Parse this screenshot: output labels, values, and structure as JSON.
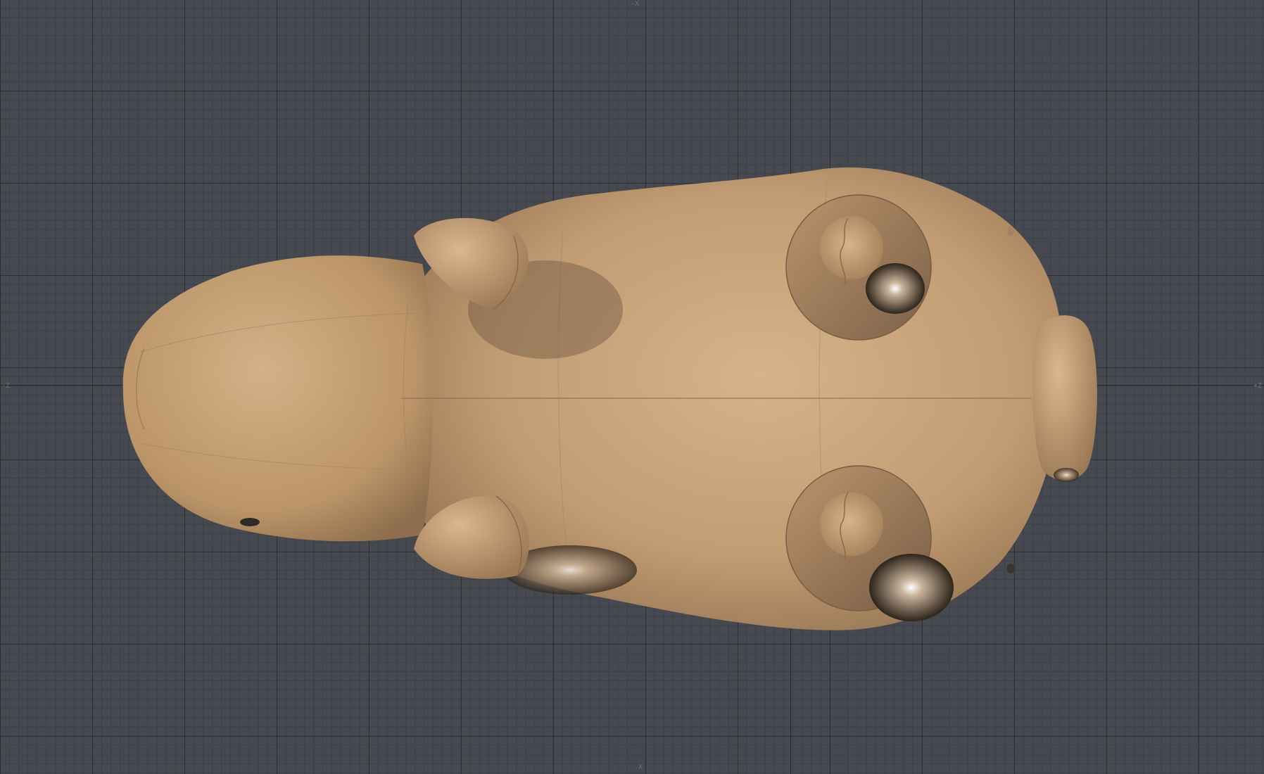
{
  "viewport": {
    "view": "top",
    "background_color": "#464a50",
    "grid_line_color": "#3c4046",
    "grid_major_color": "#24272b",
    "model_color": "#c8a47e"
  },
  "axis_labels": {
    "top": "-X",
    "bottom": "-X",
    "left": "-Z",
    "right": "+Z"
  }
}
